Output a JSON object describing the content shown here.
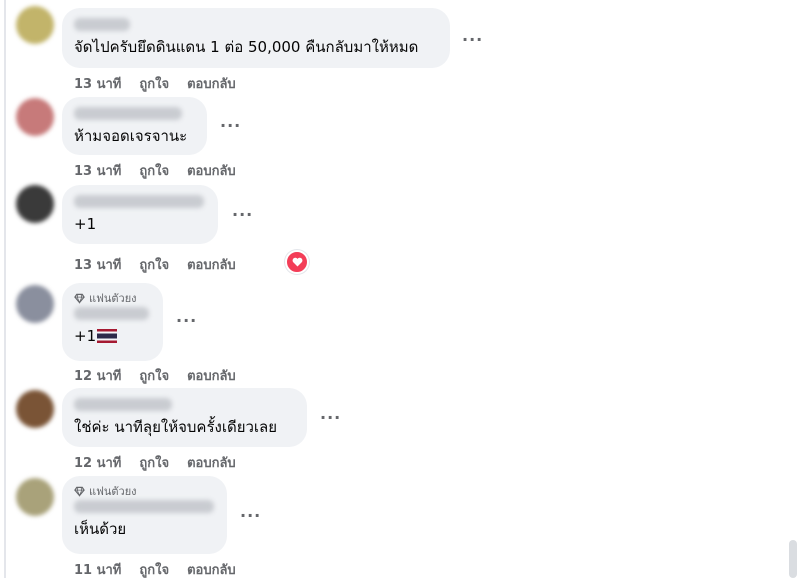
{
  "comments": [
    {
      "text": "จัดไปครับยึดดินแดน 1 ต่อ 50,000 คืนกลับมาให้หมด",
      "time": "13 นาที",
      "like": "ถูกใจ",
      "reply": "ตอบกลับ",
      "avatar_color": "#c2b46a"
    },
    {
      "text": "ห้ามจอดเจรจานะ",
      "time": "13 นาที",
      "like": "ถูกใจ",
      "reply": "ตอบกลับ",
      "avatar_color": "#c77a7a"
    },
    {
      "text": "+1",
      "time": "13 นาที",
      "like": "ถูกใจ",
      "reply": "ตอบกลับ",
      "avatar_color": "#3a3a3a",
      "reaction": "love-reaction-icon"
    },
    {
      "badge": "แฟนตัวยง",
      "text": "+1",
      "time": "12 นาที",
      "like": "ถูกใจ",
      "reply": "ตอบกลับ",
      "avatar_color": "#8a8f9e",
      "emoji": "thai-flag-icon"
    },
    {
      "text": "ใช่ค่ะ นาทีลุยให้จบครั้งเดียวเลย",
      "time": "12 นาที",
      "like": "ถูกใจ",
      "reply": "ตอบกลับ",
      "avatar_color": "#7a5436"
    },
    {
      "badge": "แฟนตัวยง",
      "text": "เห็นด้วย",
      "time": "11 นาที",
      "like": "ถูกใจ",
      "reply": "ตอบกลับ",
      "avatar_color": "#a9a27a"
    }
  ],
  "more_label": "···"
}
